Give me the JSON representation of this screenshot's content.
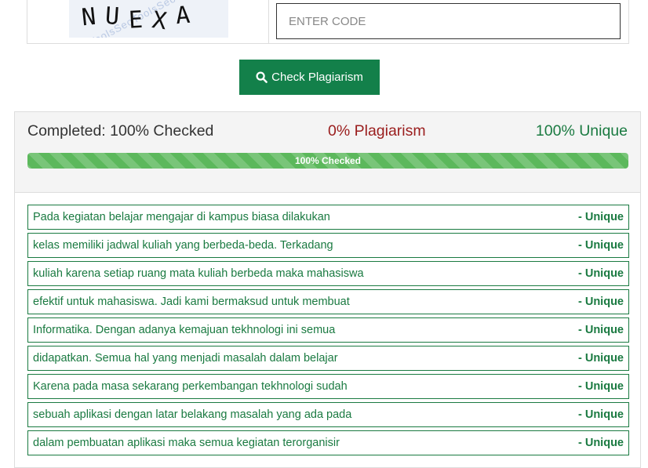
{
  "captcha": {
    "letters": [
      "N",
      "U",
      "E",
      "X",
      "A"
    ],
    "watermark": "SeoToolsSeoToolsSeoTools SeoToolsSeoToolsSeoTools SeoToolsSeoToolsSeoTools"
  },
  "code_input": {
    "placeholder": "ENTER CODE",
    "value": ""
  },
  "check_button": {
    "label": "Check Plagiarism",
    "icon": "search-icon",
    "color": "#13804a"
  },
  "results": {
    "completed": "Completed: 100% Checked",
    "plagiarism": "0% Plagiarism",
    "unique": "100% Unique",
    "progress": {
      "percent": 100,
      "label": "100% Checked"
    },
    "sentences": [
      {
        "text": "Pada kegiatan belajar mengajar di kampus biasa dilakukan",
        "status": "- Unique"
      },
      {
        "text": "kelas memiliki jadwal kuliah yang berbeda-beda. Terkadang",
        "status": "- Unique"
      },
      {
        "text": "kuliah karena setiap ruang mata kuliah berbeda maka mahasiswa",
        "status": "- Unique"
      },
      {
        "text": "efektif untuk mahasiswa. Jadi kami bermaksud untuk membuat",
        "status": "- Unique"
      },
      {
        "text": "Informatika. Dengan adanya kemajuan tekhnologi ini semua",
        "status": "- Unique"
      },
      {
        "text": "didapatkan. Semua hal yang menjadi masalah dalam belajar",
        "status": "- Unique"
      },
      {
        "text": "Karena pada masa sekarang perkembangan tekhnologi sudah",
        "status": "- Unique"
      },
      {
        "text": "sebuah aplikasi dengan latar belakang masalah yang ada pada",
        "status": "- Unique"
      },
      {
        "text": "dalam pembuatan aplikasi maka semua kegiatan terorganisir",
        "status": "- Unique"
      }
    ],
    "colors": {
      "unique": "#1a7a41",
      "plagiarism": "#9a1d1d",
      "progress": "#5cb85c"
    }
  }
}
